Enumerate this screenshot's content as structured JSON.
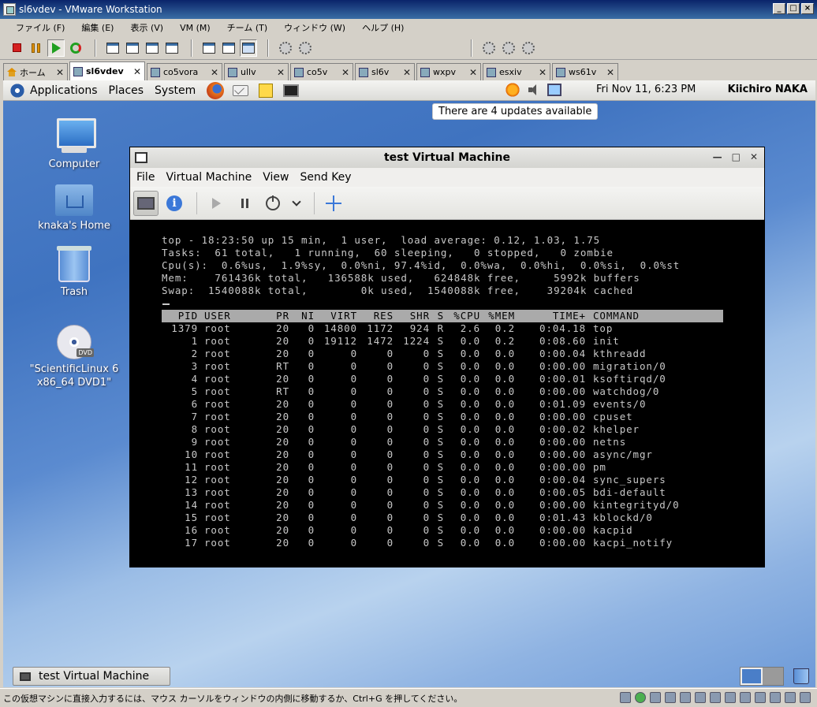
{
  "window": {
    "title": "sl6vdev - VMware Workstation"
  },
  "menubar": [
    "ファイル (F)",
    "編集 (E)",
    "表示 (V)",
    "VM (M)",
    "チーム (T)",
    "ウィンドウ (W)",
    "ヘルプ (H)"
  ],
  "tabs": [
    {
      "label": "ホーム",
      "active": false
    },
    {
      "label": "sl6vdev",
      "active": true
    },
    {
      "label": "co5vora",
      "active": false
    },
    {
      "label": "ullv",
      "active": false
    },
    {
      "label": "co5v",
      "active": false
    },
    {
      "label": "sl6v",
      "active": false
    },
    {
      "label": "wxpv",
      "active": false
    },
    {
      "label": "esxiv",
      "active": false
    },
    {
      "label": "ws61v",
      "active": false
    }
  ],
  "guest": {
    "panel": {
      "menus": [
        "Applications",
        "Places",
        "System"
      ],
      "clock": "Fri Nov 11,  6:23 PM",
      "user": "Kiichiro NAKA"
    },
    "notification": "There are 4 updates available",
    "desktop_icons": [
      {
        "label": "Computer"
      },
      {
        "label": "knaka's Home"
      },
      {
        "label": "Trash"
      },
      {
        "label": "\"ScientificLinux 6 x86_64 DVD1\""
      }
    ],
    "vm_window": {
      "title": "test Virtual Machine",
      "menus": [
        "File",
        "Virtual Machine",
        "View",
        "Send Key"
      ]
    },
    "taskbar": {
      "button": "test Virtual Machine"
    }
  },
  "console": {
    "summary": [
      "top - 18:23:50 up 15 min,  1 user,  load average: 0.12, 1.03, 1.75",
      "Tasks:  61 total,   1 running,  60 sleeping,   0 stopped,   0 zombie",
      "Cpu(s):  0.6%us,  1.9%sy,  0.0%ni, 97.4%id,  0.0%wa,  0.0%hi,  0.0%si,  0.0%st",
      "Mem:    761436k total,   136588k used,   624848k free,     5992k buffers",
      "Swap:  1540088k total,        0k used,  1540088k free,    39204k cached"
    ],
    "columns": [
      "PID",
      "USER",
      "PR",
      "NI",
      "VIRT",
      "RES",
      "SHR",
      "S",
      "%CPU",
      "%MEM",
      "TIME+",
      "COMMAND"
    ],
    "rows": [
      [
        "1379",
        "root",
        "20",
        "0",
        "14800",
        "1172",
        "924",
        "R",
        "2.6",
        "0.2",
        "0:04.18",
        "top"
      ],
      [
        "1",
        "root",
        "20",
        "0",
        "19112",
        "1472",
        "1224",
        "S",
        "0.0",
        "0.2",
        "0:08.60",
        "init"
      ],
      [
        "2",
        "root",
        "20",
        "0",
        "0",
        "0",
        "0",
        "S",
        "0.0",
        "0.0",
        "0:00.04",
        "kthreadd"
      ],
      [
        "3",
        "root",
        "RT",
        "0",
        "0",
        "0",
        "0",
        "S",
        "0.0",
        "0.0",
        "0:00.00",
        "migration/0"
      ],
      [
        "4",
        "root",
        "20",
        "0",
        "0",
        "0",
        "0",
        "S",
        "0.0",
        "0.0",
        "0:00.01",
        "ksoftirqd/0"
      ],
      [
        "5",
        "root",
        "RT",
        "0",
        "0",
        "0",
        "0",
        "S",
        "0.0",
        "0.0",
        "0:00.00",
        "watchdog/0"
      ],
      [
        "6",
        "root",
        "20",
        "0",
        "0",
        "0",
        "0",
        "S",
        "0.0",
        "0.0",
        "0:01.09",
        "events/0"
      ],
      [
        "7",
        "root",
        "20",
        "0",
        "0",
        "0",
        "0",
        "S",
        "0.0",
        "0.0",
        "0:00.00",
        "cpuset"
      ],
      [
        "8",
        "root",
        "20",
        "0",
        "0",
        "0",
        "0",
        "S",
        "0.0",
        "0.0",
        "0:00.02",
        "khelper"
      ],
      [
        "9",
        "root",
        "20",
        "0",
        "0",
        "0",
        "0",
        "S",
        "0.0",
        "0.0",
        "0:00.00",
        "netns"
      ],
      [
        "10",
        "root",
        "20",
        "0",
        "0",
        "0",
        "0",
        "S",
        "0.0",
        "0.0",
        "0:00.00",
        "async/mgr"
      ],
      [
        "11",
        "root",
        "20",
        "0",
        "0",
        "0",
        "0",
        "S",
        "0.0",
        "0.0",
        "0:00.00",
        "pm"
      ],
      [
        "12",
        "root",
        "20",
        "0",
        "0",
        "0",
        "0",
        "S",
        "0.0",
        "0.0",
        "0:00.04",
        "sync_supers"
      ],
      [
        "13",
        "root",
        "20",
        "0",
        "0",
        "0",
        "0",
        "S",
        "0.0",
        "0.0",
        "0:00.05",
        "bdi-default"
      ],
      [
        "14",
        "root",
        "20",
        "0",
        "0",
        "0",
        "0",
        "S",
        "0.0",
        "0.0",
        "0:00.00",
        "kintegrityd/0"
      ],
      [
        "15",
        "root",
        "20",
        "0",
        "0",
        "0",
        "0",
        "S",
        "0.0",
        "0.0",
        "0:01.43",
        "kblockd/0"
      ],
      [
        "16",
        "root",
        "20",
        "0",
        "0",
        "0",
        "0",
        "S",
        "0.0",
        "0.0",
        "0:00.00",
        "kacpid"
      ],
      [
        "17",
        "root",
        "20",
        "0",
        "0",
        "0",
        "0",
        "S",
        "0.0",
        "0.0",
        "0:00.00",
        "kacpi_notify"
      ]
    ]
  },
  "statusbar": {
    "message": "この仮想マシンに直接入力するには、マウス カーソルをウィンドウの内側に移動するか、Ctrl+G を押してください。"
  }
}
